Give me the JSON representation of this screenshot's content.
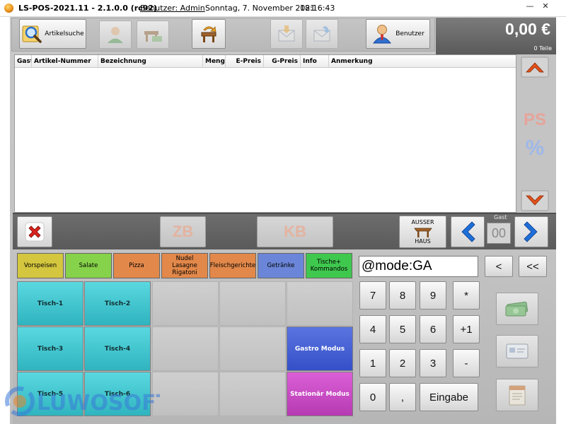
{
  "window": {
    "title": "LS-POS-2021.11 - 2.1.0.0 (rc92)",
    "user": "Benutzer: Admin",
    "date": "Sonntag, 7. November 2021",
    "time": "18:16:43",
    "minimize": "—",
    "maximize": "□",
    "close": "✕"
  },
  "toolbar": {
    "articlesearch_label": "Artikelsuche",
    "user_label": "Benutzer"
  },
  "totals": {
    "amount": "0,00 €",
    "items": "0 Teile"
  },
  "table": {
    "columns": [
      "Gast",
      "Artikel-Nummer",
      "Bezeichnung",
      "Menge",
      "E-Preis",
      "G-Preis",
      "Info",
      "Anmerkung"
    ]
  },
  "side": {
    "ps": "PS",
    "percent": "%"
  },
  "actionbar": {
    "zb": "ZB",
    "kb": "KB",
    "ausser_top": "AUSSER",
    "ausser_bottom": "HAUS",
    "gast_label": "Gast",
    "gast_value": "00"
  },
  "categories": [
    {
      "label": "Vorspeisen",
      "color": "#d4c63e"
    },
    {
      "label": "Salate",
      "color": "#86d24a"
    },
    {
      "label": "Pizza",
      "color": "#e2884a"
    },
    {
      "label": "Nudel Lasagne Rigatoni",
      "color": "#e2884a"
    },
    {
      "label": "Fleischgerichte",
      "color": "#e2884a"
    },
    {
      "label": "Getränke",
      "color": "#6b86d8"
    },
    {
      "label": "Tische+ Kommandos",
      "color": "#3fc84e"
    }
  ],
  "tiles": {
    "t1": "Tisch-1",
    "t2": "Tisch-2",
    "t3": "Tisch-3",
    "t4": "Tisch-4",
    "t5": "Tisch-5",
    "t6": "Tisch-6",
    "gastro": "Gastro Modus",
    "stationaer": "Stationär Modus"
  },
  "input": {
    "value": "@mode:GA"
  },
  "keypad": {
    "back": "<",
    "backall": "<<",
    "k7": "7",
    "k8": "8",
    "k9": "9",
    "mul": "*",
    "k4": "4",
    "k5": "5",
    "k6": "6",
    "plus1": "+1",
    "k1": "1",
    "k2": "2",
    "k3": "3",
    "minus": "-",
    "k0": "0",
    "comma": ",",
    "enter": "Eingabe"
  },
  "logo": {
    "text": "LUWOSOFT"
  },
  "colors": {
    "accent_blue": "#1f6fd8",
    "chevron_orange": "#e2521a",
    "delete_red": "#d8231c"
  }
}
